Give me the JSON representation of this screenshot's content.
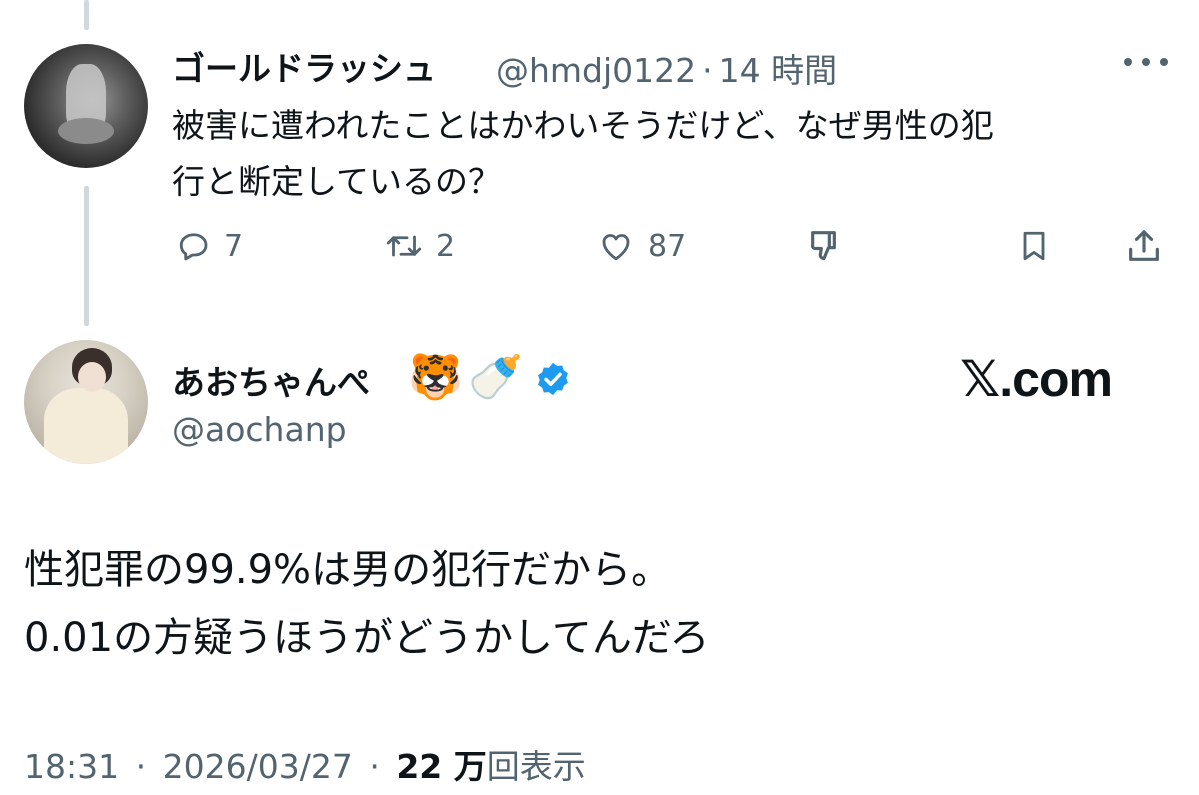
{
  "reply": {
    "name": "ゴールドラッシュ",
    "handle": "@hmdj0122",
    "sep": "·",
    "time": "14 時間",
    "text_line1": "被害に遭われたことはかわいそうだけど、なぜ男性の犯",
    "text_line2": "行と断定しているの？",
    "replies": "7",
    "reposts": "2",
    "likes": "87"
  },
  "main": {
    "name": "あおちゃんぺ",
    "emoji_tiger": "🐯",
    "emoji_bottle": "🍼",
    "handle": "@aochanp",
    "text_line1": "性犯罪の99.9%は男の犯行だから。",
    "text_line2": "0.01の方疑うほうがどうかしてんだろ",
    "time": "18:31",
    "date": "2026/03/27",
    "views_count": "22 万",
    "views_label": "回表示",
    "sep": "·"
  },
  "brand": {
    "label": "𝕏.com"
  },
  "colors": {
    "text": "#0f1419",
    "muted": "#536471",
    "verified": "#1d9bf0",
    "thread_line": "#cfd9de"
  }
}
